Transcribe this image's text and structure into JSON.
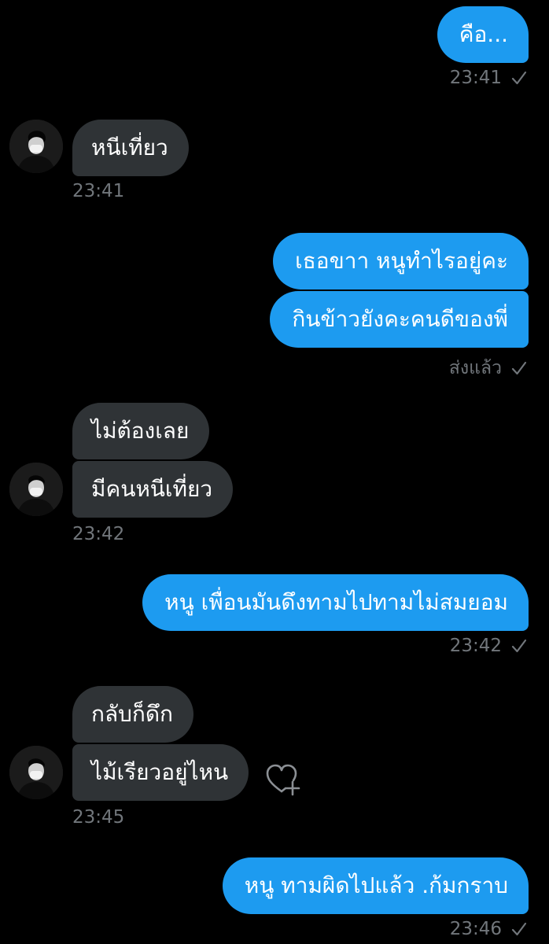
{
  "colors": {
    "background": "#000000",
    "outgoing_bubble": "#1d9bf0",
    "incoming_bubble": "#2f3336",
    "meta_text": "#71767b",
    "bubble_text": "#ffffff"
  },
  "conversation": {
    "messages": [
      {
        "direction": "outgoing",
        "text": "คือ...",
        "time": "23:41",
        "status_icon": "check-icon"
      },
      {
        "direction": "incoming",
        "text": "หนีเที่ยว",
        "time": "23:41",
        "avatar": "avatar"
      },
      {
        "direction": "outgoing",
        "text": "เธอขาา หนูทำไรอยู่คะ"
      },
      {
        "direction": "outgoing",
        "text": "กินข้าวยังคะคนดีของพี่",
        "status": "ส่งแล้ว",
        "status_icon": "check-icon"
      },
      {
        "direction": "incoming",
        "text": "ไม่ต้องเลย"
      },
      {
        "direction": "incoming",
        "text": "มีคนหนีเที่ยว",
        "time": "23:42",
        "avatar": "avatar"
      },
      {
        "direction": "outgoing",
        "text": "หนู เพื่อนมันดึงทามไปทามไม่สมยอม",
        "time": "23:42",
        "status_icon": "check-icon"
      },
      {
        "direction": "incoming",
        "text": "กลับก็ดึก"
      },
      {
        "direction": "incoming",
        "text": "ไม้เรียวอยู่ไหน",
        "time": "23:45",
        "avatar": "avatar",
        "reaction_icon": "heart-plus-icon"
      },
      {
        "direction": "outgoing",
        "text": "หนู ทามผิดไปแล้ว .ก้มกราบ",
        "time": "23:46",
        "status_icon": "check-icon"
      }
    ]
  }
}
